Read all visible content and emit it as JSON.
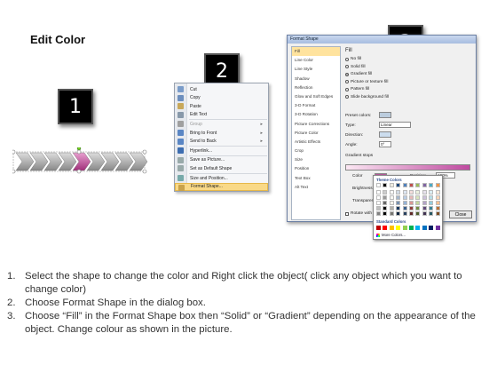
{
  "heading": "Edit Color",
  "steps": [
    "1",
    "2",
    "3"
  ],
  "context_menu": {
    "items": [
      {
        "label": "Cut",
        "underline": "t",
        "color": "#7a9cc9",
        "submenu": false
      },
      {
        "label": "Copy",
        "color": "#6d8fbe",
        "submenu": false
      },
      {
        "label": "Paste",
        "color": "#c8a85a",
        "submenu": false
      },
      {
        "label": "Edit Text",
        "color": "#8899aa",
        "submenu": false
      },
      {
        "label": "Group",
        "color": "#a0a0a0",
        "submenu": true,
        "disabled": true
      },
      {
        "label": "Bring to Front",
        "color": "#5a86c4",
        "submenu": true
      },
      {
        "label": "Send to Back",
        "color": "#5a86c4",
        "submenu": true
      },
      {
        "label": "Hyperlink...",
        "color": "#3d6db0",
        "submenu": false
      },
      {
        "label": "Save as Picture...",
        "color": "#9aa",
        "submenu": false
      },
      {
        "label": "Set as Default Shape",
        "color": "#9aa",
        "submenu": false
      },
      {
        "label": "Size and Position...",
        "color": "#7aa",
        "submenu": false
      },
      {
        "label": "Format Shape...",
        "color": "#c9a24a",
        "submenu": false,
        "selected": true
      }
    ]
  },
  "dialog": {
    "title": "Format Shape",
    "nav": [
      "Fill",
      "Line Color",
      "Line Style",
      "Shadow",
      "Reflection",
      "Glow and Soft Edges",
      "3-D Format",
      "3-D Rotation",
      "Picture Corrections",
      "Picture Color",
      "Artistic Effects",
      "Crop",
      "Size",
      "Position",
      "Text Box",
      "Alt Text"
    ],
    "nav_selected": "Fill",
    "fill_heading": "Fill",
    "fill_options": [
      {
        "label": "No fill",
        "checked": false
      },
      {
        "label": "Solid fill",
        "checked": false
      },
      {
        "label": "Gradient fill",
        "checked": true
      },
      {
        "label": "Picture or texture fill",
        "checked": false
      },
      {
        "label": "Pattern fill",
        "checked": false
      },
      {
        "label": "Slide background fill",
        "checked": false
      }
    ],
    "preset_colors_label": "Preset colors:",
    "type_label": "Type:",
    "type_value": "Linear",
    "direction_label": "Direction:",
    "angle_label": "Angle:",
    "angle_value": "0°",
    "gradient_stops_label": "Gradient stops",
    "color_label": "Color",
    "position_label": "Position:",
    "position_value": "100%",
    "brightness_label": "Brightness:",
    "transparency_label": "Transparency:",
    "rotate_label": "Rotate with shape",
    "close_label": "Close"
  },
  "color_picker": {
    "theme_label": "Theme Colors",
    "standard_label": "Standard Colors",
    "more_label": "More Colors...",
    "theme_top": [
      "#ffffff",
      "#000000",
      "#eeece1",
      "#1f497d",
      "#4f81bd",
      "#c0504d",
      "#9bbb59",
      "#8064a2",
      "#4bacc6",
      "#f79646"
    ],
    "standard": [
      "#c00000",
      "#ff0000",
      "#ffc000",
      "#ffff00",
      "#92d050",
      "#00b050",
      "#00b0f0",
      "#0070c0",
      "#002060",
      "#7030a0"
    ]
  },
  "instructions": [
    {
      "num": "1.",
      "text": "Select the shape to change the color and Right click the object( click any object which you want to change color)"
    },
    {
      "num": "2.",
      "text": "Choose Format Shape in the dialog box."
    },
    {
      "num": "3.",
      "text": "Choose “Fill” in the Format Shape box then “Solid” or “Gradient” depending on the appearance of the object. Change colour as shown in the picture."
    }
  ]
}
